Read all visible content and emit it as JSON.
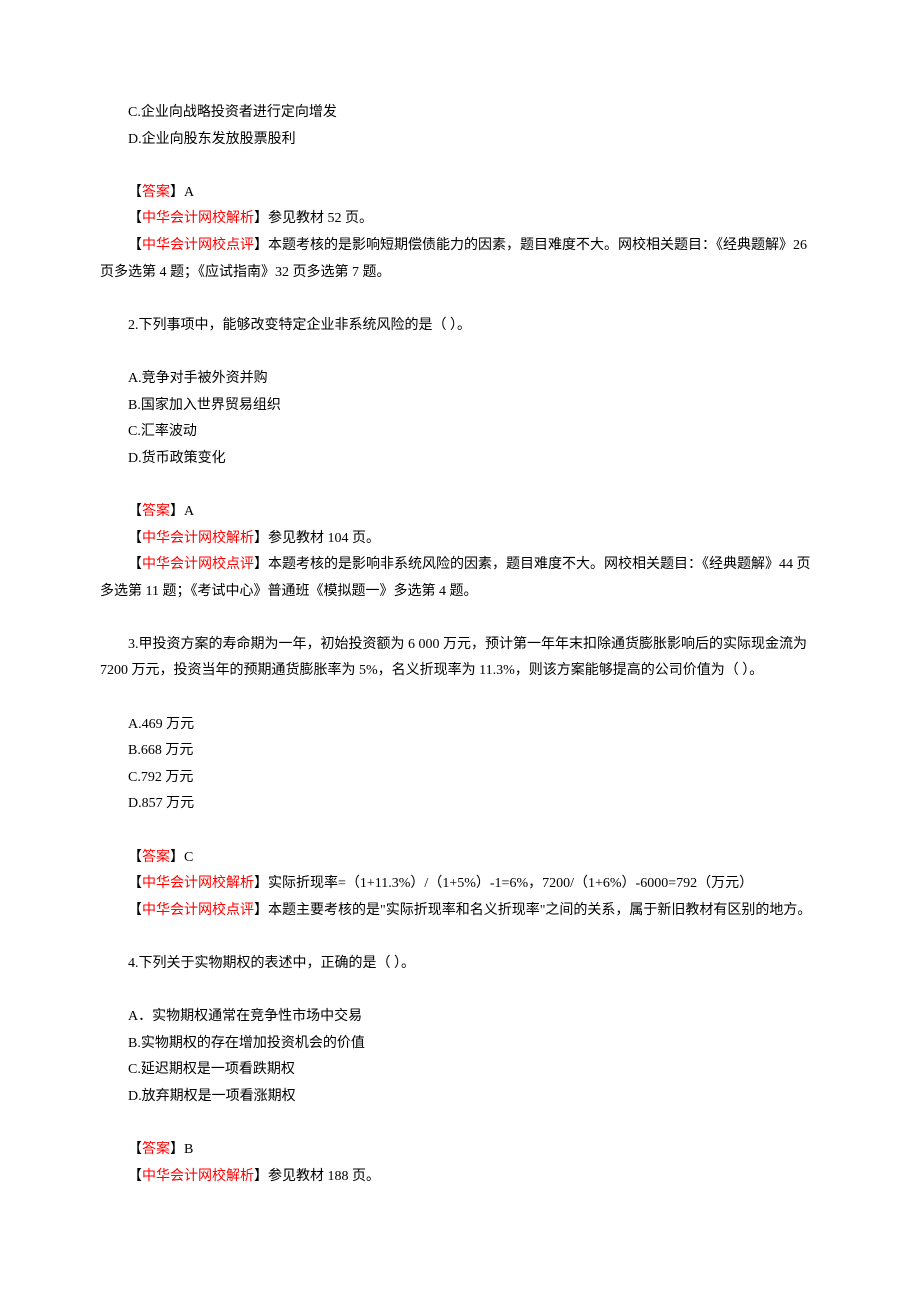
{
  "q1": {
    "optC": "C.企业向战略投资者进行定向增发",
    "optD": "D.企业向股东发放股票股利",
    "ans_label": "【答案】",
    "ans_val": "A",
    "expl_label": "【中华会计网校解析】",
    "expl_text": "参见教材 52 页。",
    "comm_label": "【中华会计网校点评】",
    "comm_text1": "本题考核的是影响短期偿债能力的因素，题目难度不大。网校相关题目：《经典题解》26 页多选第 4 题；《应试指南》32 页多选第 7 题。"
  },
  "q2": {
    "stem": "2.下列事项中，能够改变特定企业非系统风险的是（  ）。",
    "optA": "A.竞争对手被外资并购",
    "optB": "B.国家加入世界贸易组织",
    "optC": "C.汇率波动",
    "optD": "D.货币政策变化",
    "ans_label": "【答案】",
    "ans_val": "A",
    "expl_label": "【中华会计网校解析】",
    "expl_text": "参见教材 104 页。",
    "comm_label": "【中华会计网校点评】",
    "comm_text1": "本题考核的是影响非系统风险的因素，题目难度不大。网校相关题目：《经典题解》44 页多选第 11 题；《考试中心》普通班《模拟题一》多选第 4 题。"
  },
  "q3": {
    "stem": "3.甲投资方案的寿命期为一年，初始投资额为 6 000 万元，预计第一年年末扣除通货膨胀影响后的实际现金流为 7200 万元，投资当年的预期通货膨胀率为 5%，名义折现率为 11.3%，则该方案能够提高的公司价值为（  ）。",
    "optA": "A.469 万元",
    "optB": "B.668 万元",
    "optC": "C.792 万元",
    "optD": "D.857 万元",
    "ans_label": "【答案】",
    "ans_val": "C",
    "expl_label": "【中华会计网校解析】",
    "expl_text": "实际折现率=（1+11.3%）/（1+5%）-1=6%，7200/（1+6%）-6000=792（万元）",
    "comm_label": "【中华会计网校点评】",
    "comm_text1": "本题主要考核的是\"实际折现率和名义折现率\"之间的关系，属于新旧教材有区别的地方。"
  },
  "q4": {
    "stem": "4.下列关于实物期权的表述中，正确的是（  ）。",
    "optA": "A．实物期权通常在竞争性市场中交易",
    "optB": "B.实物期权的存在增加投资机会的价值",
    "optC": "C.延迟期权是一项看跌期权",
    "optD": "D.放弃期权是一项看涨期权",
    "ans_label": "【答案】",
    "ans_val": "B",
    "expl_label": "【中华会计网校解析】",
    "expl_text": "参见教材 188 页。"
  }
}
